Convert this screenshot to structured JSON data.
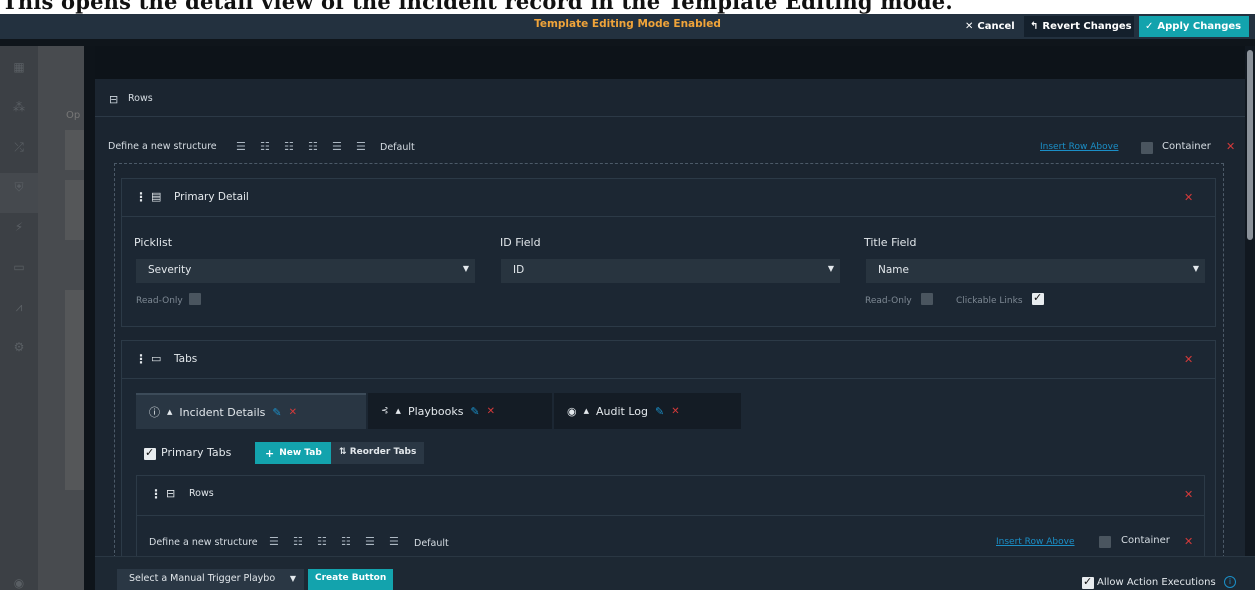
{
  "caption": "This opens the detail view of the incident record in the Template Editing mode.",
  "topbar": {
    "mode_label": "Template Editing Mode Enabled",
    "cancel_label": "Cancel",
    "revert_label": "Revert Changes",
    "apply_label": "Apply Changes"
  },
  "background_page": {
    "partial_label": "Op"
  },
  "outer_rows": {
    "title": "Rows",
    "define_label": "Define a new structure",
    "default_label": "Default",
    "insert_link": "Insert Row Above",
    "container_label": "Container"
  },
  "primary_detail": {
    "title": "Primary Detail",
    "fields": [
      {
        "label": "Picklist",
        "value": "Severity"
      },
      {
        "label": "ID Field",
        "value": "ID"
      },
      {
        "label": "Title Field",
        "value": "Name"
      }
    ],
    "read_only_label": "Read-Only",
    "clickable_links_label": "Clickable Links",
    "clickable_links_checked": true
  },
  "tabs_panel": {
    "title": "Tabs",
    "tabs": [
      {
        "label": "Incident Details",
        "icon": "info-icon",
        "active": true
      },
      {
        "label": "Playbooks",
        "icon": "playbook-icon",
        "active": false
      },
      {
        "label": "Audit Log",
        "icon": "eye-icon",
        "active": false
      }
    ],
    "primary_tabs_label": "Primary Tabs",
    "primary_tabs_checked": true,
    "new_tab_label": "New Tab",
    "reorder_label": "Reorder Tabs"
  },
  "inner_rows": {
    "title": "Rows",
    "define_label": "Define a new structure",
    "default_label": "Default",
    "insert_link": "Insert Row Above",
    "container_label": "Container"
  },
  "footer": {
    "trigger_select": "Select a Manual Trigger Playbo",
    "create_button": "Create Button",
    "allow_label": "Allow Action Executions",
    "allow_checked": true
  }
}
